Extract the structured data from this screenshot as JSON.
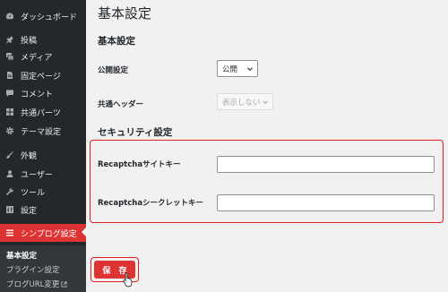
{
  "sidebar": {
    "items": [
      {
        "label": "ダッシュボード",
        "icon": "dashboard-icon"
      },
      {
        "label": "投稿",
        "icon": "pin-icon"
      },
      {
        "label": "メディア",
        "icon": "media-icon"
      },
      {
        "label": "固定ページ",
        "icon": "page-icon"
      },
      {
        "label": "コメント",
        "icon": "comment-icon"
      },
      {
        "label": "共通パーツ",
        "icon": "parts-icon"
      },
      {
        "label": "テーマ設定",
        "icon": "gear-icon"
      },
      {
        "label": "外観",
        "icon": "brush-icon"
      },
      {
        "label": "ユーザー",
        "icon": "user-icon"
      },
      {
        "label": "ツール",
        "icon": "wrench-icon"
      },
      {
        "label": "設定",
        "icon": "settings-icon"
      },
      {
        "label": "シンプログ設定",
        "icon": "menu-icon",
        "active": true
      }
    ],
    "submenu": [
      {
        "label": "基本設定",
        "current": true
      },
      {
        "label": "プラグイン設定"
      },
      {
        "label": "ブログURL変更",
        "icon": "external-link-icon"
      }
    ]
  },
  "main": {
    "page_title": "基本設定",
    "basic_section_title": "基本設定",
    "public_label": "公開設定",
    "public_value": "公開",
    "header_label": "共通ヘッダー",
    "header_value": "表示しない",
    "security_section_title": "セキュリティ設定",
    "site_key_label": "Recaptchaサイトキー",
    "site_key_value": "",
    "secret_key_label": "Recaptchaシークレットキー",
    "secret_key_value": "",
    "save_label": "保 存"
  },
  "colors": {
    "sidebar_bg": "#23282d",
    "accent": "#dd3333",
    "highlight_border": "#e02020",
    "content_bg": "#f1f1f1"
  }
}
